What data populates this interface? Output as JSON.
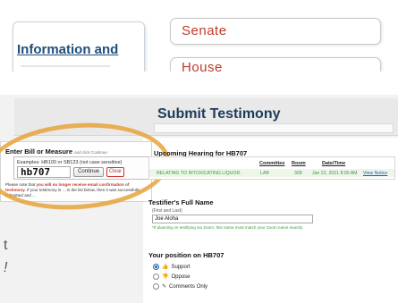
{
  "background": {
    "info_card_text": "Information and",
    "senate_label": "Senate",
    "house_label": "House"
  },
  "side_marks": [
    ".",
    "t",
    "!"
  ],
  "page": {
    "title": "Submit Testimony"
  },
  "bill_entry": {
    "heading": "Enter Bill or Measure",
    "heading_hint": "and click Continue",
    "examples": "Examples: HB100 or SB123 (not case sensitive)",
    "input_value": "hb707",
    "continue_label": "Continue",
    "clear_label": "Clear",
    "note_prefix": "Please note that ",
    "note_emphasis": "you will no longer receive email confirmation of testimony.",
    "note_suffix": " If your testimony is ... in the list below, then it was successfully submitted and ..."
  },
  "hearing": {
    "title": "Upcoming Hearing for HB707",
    "columns": [
      "Committee",
      "Room",
      "Date/Time"
    ],
    "row": {
      "measure": "RELATING TO INTOXICATING LIQUOR.",
      "committee": "LAB",
      "room": "309",
      "datetime": "Jan 22, 2021 8:00 AM",
      "notice_link": "View Notice"
    }
  },
  "testifier": {
    "label": "Testifier's Full Name",
    "sublabel": "(First and Last)",
    "value": "Joe Aloha",
    "hint": "*If planning on testifying via Zoom, this name must match your Zoom name exactly."
  },
  "position": {
    "label": "Your position on HB707",
    "options": [
      {
        "label": "Support",
        "icon": "thumbs-up-icon",
        "glyph": "👍",
        "selected": true
      },
      {
        "label": "Oppose",
        "icon": "thumbs-down-icon",
        "glyph": "👎",
        "selected": false
      },
      {
        "label": "Comments Only",
        "icon": "edit-icon",
        "glyph": "✎",
        "selected": false
      }
    ]
  },
  "colors": {
    "accent": "#1f3b5c",
    "highlight": "#e8a33a",
    "alert": "#c0392b",
    "green_text": "#3a9a3a"
  }
}
